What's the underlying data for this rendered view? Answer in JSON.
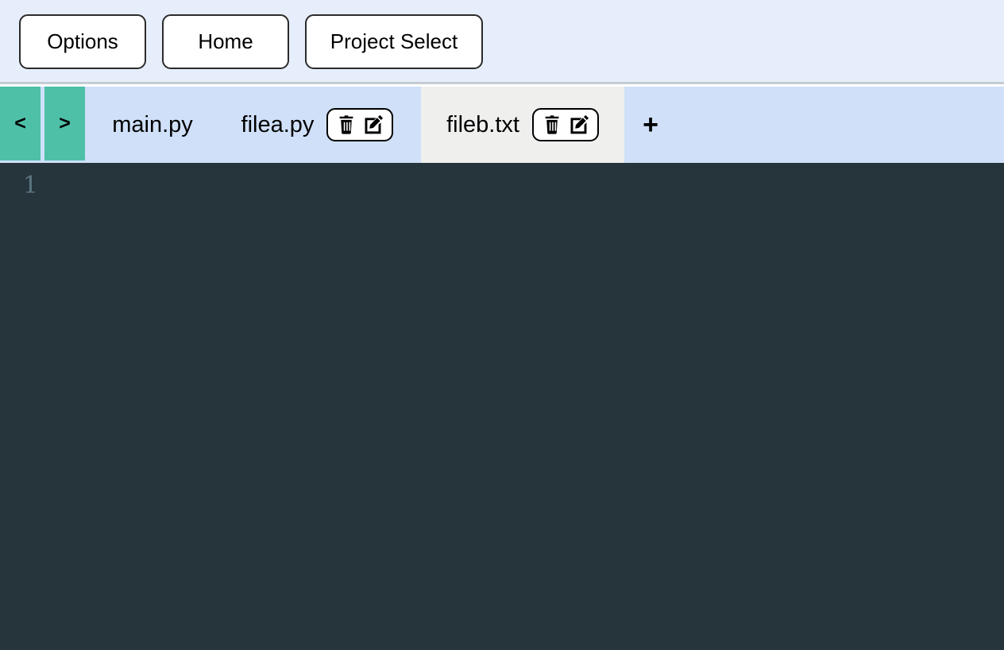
{
  "toolbar": {
    "buttons": [
      {
        "id": "options",
        "label": "Options"
      },
      {
        "id": "home",
        "label": "Home"
      },
      {
        "id": "project_select",
        "label": "Project Select"
      }
    ]
  },
  "tabbar": {
    "nav_prev_label": "<",
    "nav_next_label": ">",
    "add_tab_label": "+",
    "tabs": [
      {
        "label": "main.py",
        "active": false,
        "has_actions": false
      },
      {
        "label": "filea.py",
        "active": false,
        "has_actions": true
      },
      {
        "label": "fileb.txt",
        "active": true,
        "has_actions": true
      }
    ],
    "action_icons": {
      "delete": "trash-icon",
      "rename": "edit-pencil-icon"
    }
  },
  "editor": {
    "line_numbers": [
      "1"
    ],
    "content": "",
    "background_color": "#26343b",
    "line_number_color": "#5b7682"
  },
  "colors": {
    "toolbar_background": "#e7eefb",
    "tabbar_background": "#cfe0f8",
    "nav_button": "#4ec0a8",
    "active_tab": "#efefee",
    "inactive_tab": "#cfe0f8",
    "editor_background": "#26343b"
  }
}
